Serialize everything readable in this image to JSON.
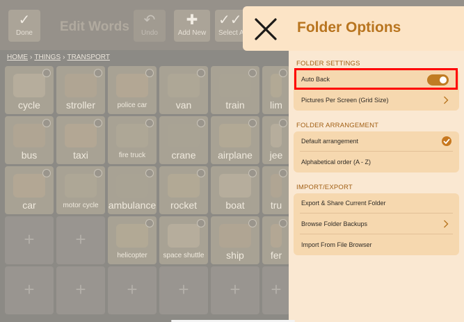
{
  "toolbar": {
    "done_label": "Done",
    "title": "Edit Words",
    "undo_label": "Undo",
    "add_new_label": "Add New",
    "select_label": "Select A"
  },
  "breadcrumb": [
    "HOME",
    "THINGS",
    "TRANSPORT"
  ],
  "grid": {
    "rows": [
      [
        "cycle",
        "stroller",
        "police car",
        "van",
        "train",
        "lim"
      ],
      [
        "bus",
        "taxi",
        "fire truck",
        "crane",
        "airplane",
        "jee"
      ],
      [
        "car",
        "motor cycle",
        "ambulance",
        "rocket",
        "boat",
        "tru"
      ],
      [
        "",
        "",
        "helicopter",
        "space shuttle",
        "ship",
        "fer"
      ],
      [
        "",
        "",
        "",
        "",
        "",
        ""
      ]
    ]
  },
  "panel": {
    "title": "Folder Options",
    "sections": [
      {
        "title": "FOLDER SETTINGS",
        "rows": [
          {
            "label": "Auto Back",
            "control": "toggle",
            "on": true
          },
          {
            "label": "Pictures Per Screen (Grid Size)",
            "control": "chevron"
          }
        ]
      },
      {
        "title": "FOLDER ARRANGEMENT",
        "rows": [
          {
            "label": "Default arrangement",
            "control": "check",
            "selected": true
          },
          {
            "label": "Alphabetical order (A - Z)",
            "control": "none"
          }
        ]
      },
      {
        "title": "IMPORT/EXPORT",
        "rows": [
          {
            "label": "Export & Share Current Folder",
            "control": "none"
          },
          {
            "label": "Browse Folder Backups",
            "control": "chevron"
          },
          {
            "label": "Import From File Browser",
            "control": "none"
          }
        ]
      }
    ]
  },
  "colors": {
    "accent": "#b8741e",
    "panel_bg": "#fae8d2",
    "group_bg": "#f6d8af",
    "highlight": "#ff0000"
  }
}
